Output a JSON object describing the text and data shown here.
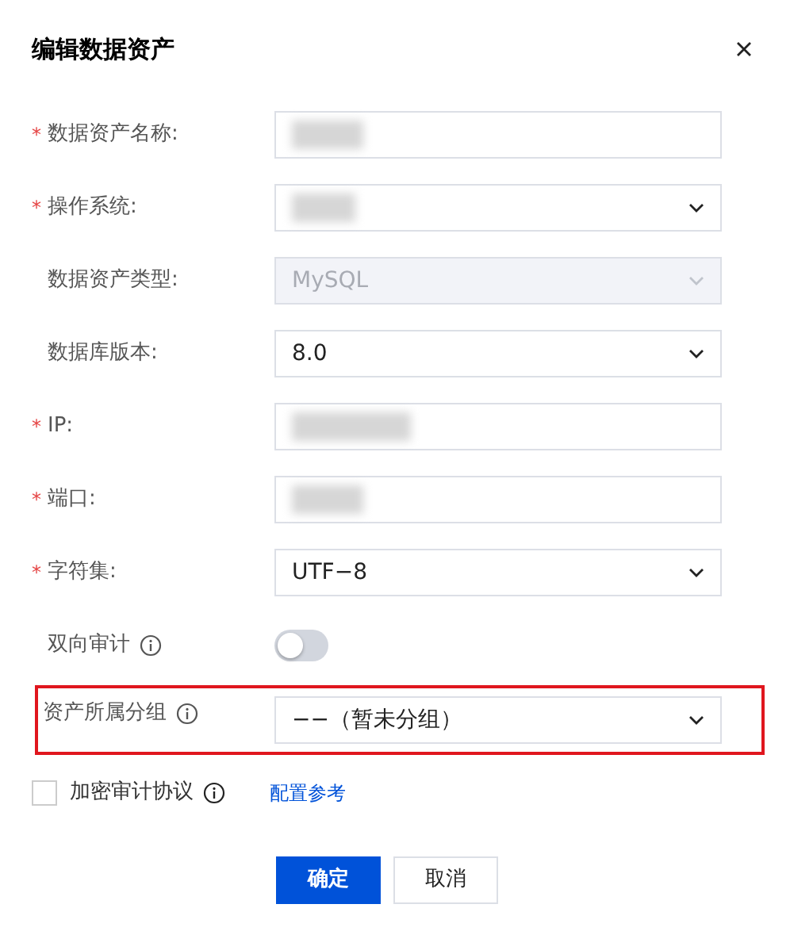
{
  "dialog": {
    "title": "编辑数据资产"
  },
  "fields": [
    {
      "kind": "input",
      "asterisk": "*",
      "label": "数据资产名称:",
      "redacted": true,
      "disabled": false
    },
    {
      "kind": "select",
      "asterisk": "*",
      "label": "操作系统:",
      "redacted": true,
      "disabled": false
    },
    {
      "kind": "select",
      "label": "数据资产类型:",
      "value": "MySQL",
      "disabled": true
    },
    {
      "kind": "select",
      "label": "数据库版本:",
      "value": "8.0",
      "disabled": false
    },
    {
      "kind": "input",
      "asterisk": "*",
      "label": "IP:",
      "redacted": true,
      "disabled": false
    },
    {
      "kind": "input",
      "asterisk": "*",
      "label": "端口:",
      "redacted": true,
      "disabled": false
    },
    {
      "kind": "select",
      "asterisk": "*",
      "label": "字符集:",
      "value": "UTF−8",
      "disabled": false
    },
    {
      "kind": "toggle",
      "label": "双向审计",
      "info": true,
      "on": false,
      "disabled": false
    },
    {
      "kind": "select",
      "label": "资产所属分组",
      "info": true,
      "value": "−−（暂未分组）",
      "disabled": false,
      "highlighted": true
    }
  ],
  "encryption": {
    "label": "加密审计协议",
    "checked": false,
    "info": true,
    "link": "配置参考"
  },
  "buttons": [
    {
      "label": "确定",
      "primary": true
    },
    {
      "label": "取消",
      "primary": false
    }
  ]
}
